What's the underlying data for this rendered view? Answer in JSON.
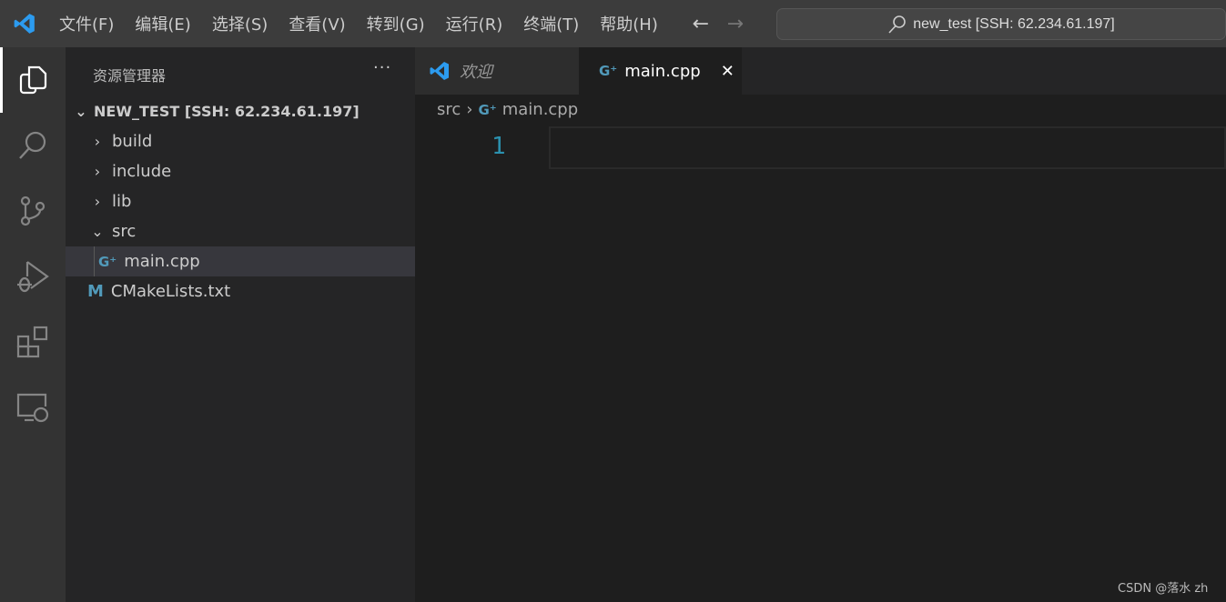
{
  "titlebar": {
    "menus": [
      "文件(F)",
      "编辑(E)",
      "选择(S)",
      "查看(V)",
      "转到(G)",
      "运行(R)",
      "终端(T)",
      "帮助(H)"
    ],
    "back": "←",
    "forward": "→",
    "command_center": "new_test [SSH: 62.234.61.197]"
  },
  "sidebar": {
    "title": "资源管理器",
    "more": "···",
    "root": "NEW_TEST [SSH: 62.234.61.197]",
    "items": [
      {
        "label": "build"
      },
      {
        "label": "include"
      },
      {
        "label": "lib"
      },
      {
        "label": "src"
      },
      {
        "label": "main.cpp"
      },
      {
        "label": "CMakeLists.txt"
      }
    ]
  },
  "tabs": [
    {
      "label": "欢迎"
    },
    {
      "label": "main.cpp",
      "close": "✕"
    }
  ],
  "breadcrumb": [
    "src",
    "main.cpp"
  ],
  "editor": {
    "line_numbers": [
      "1"
    ]
  },
  "watermark": "CSDN @落水 zh",
  "colors": {
    "accent": "#007acc",
    "cpp_icon": "#519aba",
    "line_number": "#2b91af"
  }
}
